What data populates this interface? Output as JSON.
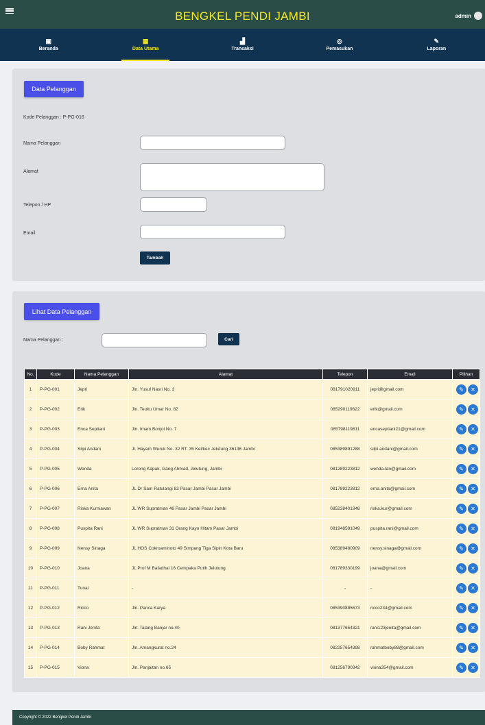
{
  "app": {
    "title": "BENGKEL PENDI JAMBI",
    "user": "admin"
  },
  "nav": [
    {
      "icon": "dashboard-icon",
      "glyph": "▣",
      "label": "Beranda"
    },
    {
      "icon": "grid-icon",
      "glyph": "▦",
      "label": "Data Utama"
    },
    {
      "icon": "chart-icon",
      "glyph": "▟",
      "label": "Transaksi"
    },
    {
      "icon": "target-icon",
      "glyph": "◎",
      "label": "Pemasukan"
    },
    {
      "icon": "wrench-icon",
      "glyph": "✎",
      "label": "Laporan"
    }
  ],
  "form": {
    "section_title": "Data Pelanggan",
    "kode": "Kode Pelanggan : P-PG-016",
    "nama_label": "Nama Pelanggan",
    "nama_value": "",
    "alamat_label": "Alamat",
    "alamat_value": "",
    "telepon_label": "Telepon / HP",
    "telepon_value": "",
    "email_label": "Email",
    "email_value": "",
    "submit_label": "Tambah"
  },
  "search": {
    "section_title": "Lihat Data Pelanggan",
    "label": "Nama Pelanggan :",
    "value": "",
    "button_label": "Cari"
  },
  "table": {
    "headers": [
      "No.",
      "Kode",
      "Nama Pelanggan",
      "Alamat",
      "Telepon",
      "Email",
      "Pilihan"
    ],
    "rows": [
      {
        "no": "1",
        "kode": "P-PG-001",
        "nama": "Jepri",
        "alamat": "Jln. Yusuf Nasri No. 3",
        "telepon": "081791020911",
        "email": "jepri@gmail.com"
      },
      {
        "no": "2",
        "kode": "P-PG-002",
        "nama": "Erik",
        "alamat": "Jln. Teuku Umar No. 82",
        "telepon": "085290119822",
        "email": "erik@gmail.com"
      },
      {
        "no": "3",
        "kode": "P-PG-003",
        "nama": "Enca Septiani",
        "alamat": "Jln. Imam Bonjol No. 7",
        "telepon": "085798119811",
        "email": "encaseptiani21@gmail.com"
      },
      {
        "no": "4",
        "kode": "P-PG-004",
        "nama": "Silpi Andani",
        "alamat": "Jl. Hayam Wuruk No. 32 RT. 35 Kel/kec Jelutung 36136 Jambi",
        "telepon": "085389891288",
        "email": "silpi.andani@gmail.com"
      },
      {
        "no": "5",
        "kode": "P-PG-005",
        "nama": "Wenda",
        "alamat": "Lorong Kapak, Gang Ahmad, Jelutung, Jambi",
        "telepon": "081289223812",
        "email": "wenda.tan@gmail.com"
      },
      {
        "no": "6",
        "kode": "P-PG-006",
        "nama": "Erna Anita",
        "alamat": "JL Dr Sam Ratulangi 83 Pasar Jambi Pasar Jambi",
        "telepon": "081789223812",
        "email": "erna.anita@gmail.com"
      },
      {
        "no": "7",
        "kode": "P-PG-007",
        "nama": "Riska Kurniawan",
        "alamat": "JL WR Supratman 46 Pasar Jambi Pasar Jambi",
        "telepon": "085238401948",
        "email": "riska.kur@gmail.com"
      },
      {
        "no": "8",
        "kode": "P-PG-008",
        "nama": "Puspita Rani",
        "alamat": "JL WR Supratman 31 Orang Kayo Hitam Pasar Jambi",
        "telepon": "081948591049",
        "email": "puspita.rani@gmail.com"
      },
      {
        "no": "9",
        "kode": "P-PG-009",
        "nama": "Nensy Sinaga",
        "alamat": "JL HOS Cokroaminoto 49 Simpang Tiga Sipin Kota Baru",
        "telepon": "085389480909",
        "email": "nensy.sinaga@gmail.com"
      },
      {
        "no": "10",
        "kode": "P-PG-010",
        "nama": "Joana",
        "alamat": "JL Prof M Bafadhal 16 Cempaka Putih Jelutung",
        "telepon": "081789330199",
        "email": "joana@gmail.com"
      },
      {
        "no": "11",
        "kode": "P-PG-011",
        "nama": "Tunai",
        "alamat": "-",
        "telepon": "-",
        "email": "-"
      },
      {
        "no": "12",
        "kode": "P-PG-012",
        "nama": "Ricco",
        "alamat": "Jln. Panca Karya",
        "telepon": "085390885673",
        "email": "ricco234@gmail.com"
      },
      {
        "no": "13",
        "kode": "P-PG-013",
        "nama": "Rani Jenita",
        "alamat": "Jln. Talang Banjar no.40",
        "telepon": "081377654321",
        "email": "rani123jenita@gmail.com"
      },
      {
        "no": "14",
        "kode": "P-PG-014",
        "nama": "Boby Rahmat",
        "alamat": "Jln. Amangkurat no.24",
        "telepon": "082257654398",
        "email": "rahmatboby88@gmail.com"
      },
      {
        "no": "15",
        "kode": "P-PG-015",
        "nama": "Viona",
        "alamat": "Jln. Panjaitan no.65",
        "telepon": "081256790342",
        "email": "viona354@gmail.com"
      }
    ]
  },
  "footer": {
    "text": "Copyright © 2022 Bengkel Pendi Jambi"
  },
  "colors": {
    "header": "#2b4d47",
    "nav": "#0f3350",
    "accent": "#f5e82a",
    "section_button": "#4a4fe8",
    "row": "#fcf4d4",
    "action": "#2a78d1"
  }
}
